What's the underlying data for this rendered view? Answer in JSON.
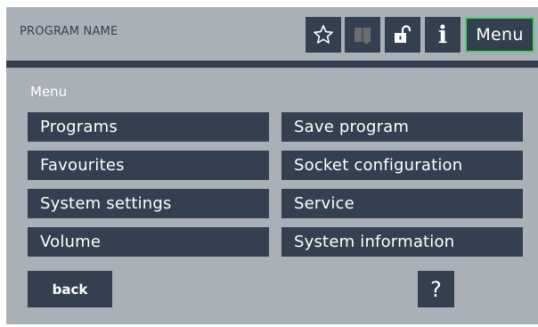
{
  "header": {
    "program_name": "PROGRAM NAME",
    "buttons": {
      "favourite_icon": "star-icon",
      "book_icon": "book-icon",
      "lock_icon": "unlock-icon",
      "info_icon": "info-icon",
      "info_glyph": "i",
      "menu_label": "Menu"
    },
    "active_button_color": "#4fd068"
  },
  "menu": {
    "section_label": "Menu",
    "left_items": [
      {
        "label": "Programs"
      },
      {
        "label": "Favourites"
      },
      {
        "label": "System settings"
      },
      {
        "label": "Volume"
      }
    ],
    "right_items": [
      {
        "label": "Save program"
      },
      {
        "label": "Socket configuration"
      },
      {
        "label": "Service"
      },
      {
        "label": "System information"
      }
    ]
  },
  "footer": {
    "back_label": "back",
    "help_label": "?"
  },
  "colors": {
    "background": "#aab0b8",
    "button": "#34404f",
    "text_light": "#ffffff"
  }
}
